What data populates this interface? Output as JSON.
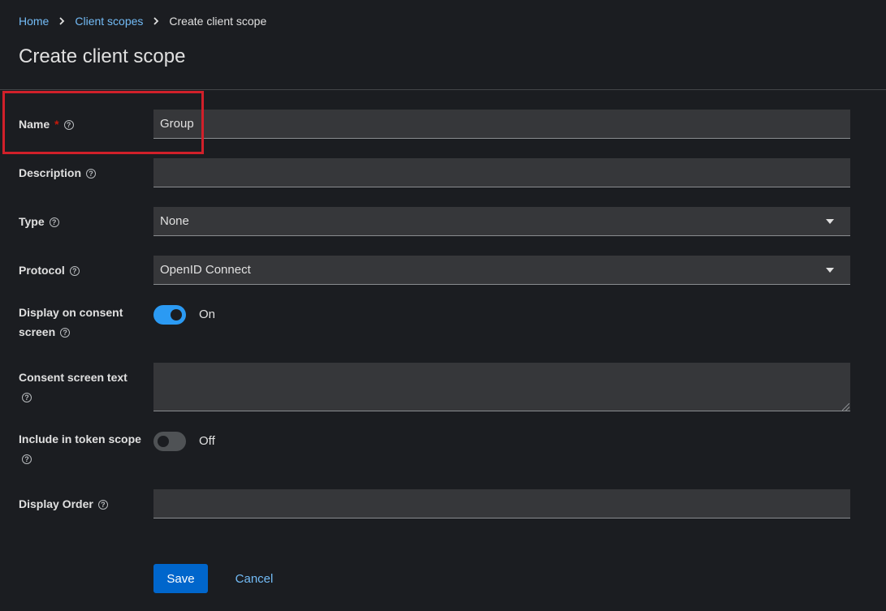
{
  "breadcrumb": {
    "home": "Home",
    "client_scopes": "Client scopes",
    "current": "Create client scope"
  },
  "page_title": "Create client scope",
  "form": {
    "name": {
      "label": "Name",
      "required_mark": "*",
      "value": "Group"
    },
    "description": {
      "label": "Description",
      "value": ""
    },
    "type": {
      "label": "Type",
      "value": "None"
    },
    "protocol": {
      "label": "Protocol",
      "value": "OpenID Connect"
    },
    "display_on_consent": {
      "label_line1": "Display on consent",
      "label_line2": "screen",
      "state": "On"
    },
    "consent_screen_text": {
      "label": "Consent screen text",
      "value": ""
    },
    "include_in_token_scope": {
      "label": "Include in token scope",
      "state": "Off"
    },
    "display_order": {
      "label": "Display Order",
      "value": ""
    }
  },
  "help_glyph": "?",
  "actions": {
    "save": "Save",
    "cancel": "Cancel"
  },
  "colors": {
    "accent": "#2b9af3",
    "primary_button": "#0066cc",
    "link": "#73bcf7",
    "required": "#c9190b",
    "highlight": "#d1202a"
  }
}
